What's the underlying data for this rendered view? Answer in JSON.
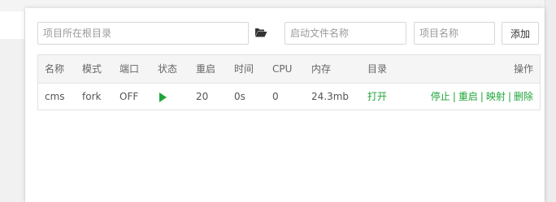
{
  "form": {
    "path_placeholder": "项目所在根目录",
    "startfile_placeholder": "启动文件名称",
    "name_placeholder": "项目名称",
    "folder_icon": "folder-open-icon",
    "add_label": "添加"
  },
  "table": {
    "headers": [
      "名称",
      "模式",
      "端口",
      "状态",
      "重启",
      "时间",
      "CPU",
      "内存",
      "目录",
      "操作"
    ],
    "rows": [
      {
        "name": "cms",
        "mode": "fork",
        "port": "OFF",
        "status_icon": "play-icon",
        "restart": "20",
        "time": "0s",
        "cpu": "0",
        "memory": "24.3mb",
        "dir_link": "打开",
        "actions": [
          "停止",
          "重启",
          "映射",
          "删除"
        ],
        "action_separator": "|"
      }
    ]
  },
  "colors": {
    "accent_green": "#20a53a",
    "header_bg": "#f5f5f5",
    "border": "#e2e2e2"
  }
}
